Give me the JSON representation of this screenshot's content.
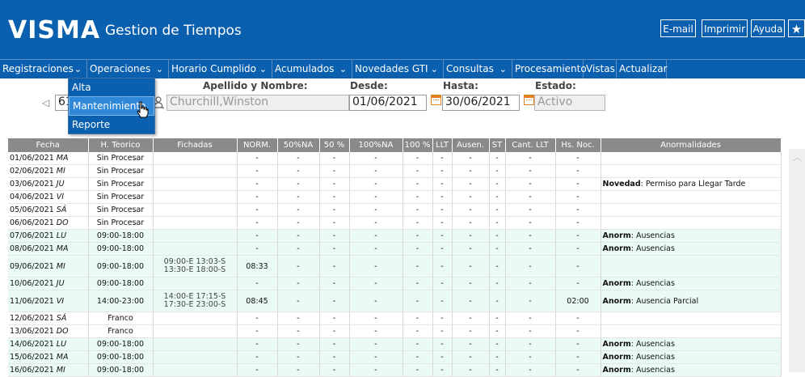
{
  "header": {
    "logo": "VISMA",
    "title": "Gestion de Tiempos",
    "buttons": {
      "email": "E-mail",
      "print": "Imprimir",
      "help": "Ayuda"
    },
    "star_icon": "star-icon"
  },
  "menu": [
    {
      "label": "Registraciones",
      "chevron": "⌄"
    },
    {
      "label": "Operaciones",
      "chevron": "⌄"
    },
    {
      "label": "Horario Cumplido",
      "chevron": "⌄"
    },
    {
      "label": "Acumulados",
      "chevron": "⌄"
    },
    {
      "label": "Novedades GTI",
      "chevron": "⌄"
    },
    {
      "label": "Consultas",
      "chevron": "⌄"
    },
    {
      "label": "Procesamiento",
      "chevron": ""
    },
    {
      "label": "Vistas",
      "chevron": ""
    },
    {
      "label": "Actualizar",
      "chevron": ""
    }
  ],
  "dropdown": [
    "Alta",
    "Mantenimiento",
    "Reporte"
  ],
  "form": {
    "name_label": "Apellido y Nombre:",
    "name_value": "Churchill,Winston",
    "legajo_value": "61",
    "desde_label": "Desde:",
    "desde_value": "01/06/2021",
    "hasta_label": "Hasta:",
    "hasta_value": "30/06/2021",
    "estado_label": "Estado:",
    "estado_value": "Activo"
  },
  "table": {
    "columns": [
      "Fecha",
      "H. Teorico",
      "Fichadas",
      "NORM.",
      "50%NA",
      "50 %",
      "100%NA",
      "100 %",
      "LLT",
      "Ausen.",
      "ST",
      "Cant. LLT",
      "Hs. Noc.",
      "Anormalidades"
    ],
    "rows": [
      {
        "date": "01/06/2021",
        "day": "MA",
        "teorico": "Sin Procesar",
        "tclass": "red",
        "f1": "",
        "f2": "",
        "norm": "-",
        "c50na": "-",
        "c50": "-",
        "c100na": "-",
        "c100": "-",
        "llt": "-",
        "ausen": "-",
        "st": "-",
        "cllt": "-",
        "noc": "-",
        "akey": "",
        "aval": "",
        "weekday": false
      },
      {
        "date": "02/06/2021",
        "day": "MI",
        "teorico": "Sin Procesar",
        "tclass": "red",
        "f1": "",
        "f2": "",
        "norm": "-",
        "c50na": "-",
        "c50": "-",
        "c100na": "-",
        "c100": "-",
        "llt": "-",
        "ausen": "-",
        "st": "-",
        "cllt": "-",
        "noc": "-",
        "akey": "",
        "aval": "",
        "weekday": false
      },
      {
        "date": "03/06/2021",
        "day": "JU",
        "teorico": "Sin Procesar",
        "tclass": "red",
        "f1": "",
        "f2": "",
        "norm": "-",
        "c50na": "-",
        "c50": "-",
        "c100na": "-",
        "c100": "-",
        "llt": "-",
        "ausen": "-",
        "st": "-",
        "cllt": "-",
        "noc": "-",
        "akey": "Novedad",
        "aval": ": Permiso para Llegar Tarde",
        "weekday": false
      },
      {
        "date": "04/06/2021",
        "day": "VI",
        "teorico": "Sin Procesar",
        "tclass": "red",
        "f1": "",
        "f2": "",
        "norm": "-",
        "c50na": "-",
        "c50": "-",
        "c100na": "-",
        "c100": "-",
        "llt": "-",
        "ausen": "-",
        "st": "-",
        "cllt": "-",
        "noc": "-",
        "akey": "",
        "aval": "",
        "weekday": false
      },
      {
        "date": "05/06/2021",
        "day": "SÁ",
        "teorico": "Sin Procesar",
        "tclass": "red",
        "f1": "",
        "f2": "",
        "norm": "-",
        "c50na": "-",
        "c50": "-",
        "c100na": "-",
        "c100": "-",
        "llt": "-",
        "ausen": "-",
        "st": "-",
        "cllt": "-",
        "noc": "-",
        "akey": "",
        "aval": "",
        "weekday": false
      },
      {
        "date": "06/06/2021",
        "day": "DO",
        "teorico": "Sin Procesar",
        "tclass": "red",
        "f1": "",
        "f2": "",
        "norm": "-",
        "c50na": "-",
        "c50": "-",
        "c100na": "-",
        "c100": "-",
        "llt": "-",
        "ausen": "-",
        "st": "-",
        "cllt": "-",
        "noc": "-",
        "akey": "",
        "aval": "",
        "weekday": false
      },
      {
        "date": "07/06/2021",
        "day": "LU",
        "teorico": "09:00-18:00",
        "tclass": "",
        "f1": "",
        "f2": "",
        "norm": "-",
        "c50na": "-",
        "c50": "-",
        "c100na": "-",
        "c100": "-",
        "llt": "-",
        "ausen": "-",
        "st": "-",
        "cllt": "-",
        "noc": "-",
        "akey": "Anorm",
        "aval": ": Ausencias",
        "weekday": true
      },
      {
        "date": "08/06/2021",
        "day": "MA",
        "teorico": "09:00-18:00",
        "tclass": "",
        "f1": "",
        "f2": "",
        "norm": "-",
        "c50na": "-",
        "c50": "-",
        "c100na": "-",
        "c100": "-",
        "llt": "-",
        "ausen": "-",
        "st": "-",
        "cllt": "-",
        "noc": "-",
        "akey": "Anorm",
        "aval": ": Ausencias",
        "weekday": true
      },
      {
        "date": "09/06/2021",
        "day": "MI",
        "teorico": "09:00-18:00",
        "tclass": "",
        "f1": "09:00-E 13:03-S",
        "f2": "13:30-E 18:00-S",
        "norm": "08:33",
        "c50na": "-",
        "c50": "-",
        "c100na": "-",
        "c100": "-",
        "llt": "-",
        "ausen": "-",
        "st": "-",
        "cllt": "-",
        "noc": "-",
        "akey": "",
        "aval": "",
        "weekday": true
      },
      {
        "date": "10/06/2021",
        "day": "JU",
        "teorico": "09:00-18:00",
        "tclass": "",
        "f1": "",
        "f2": "",
        "norm": "-",
        "c50na": "-",
        "c50": "-",
        "c100na": "-",
        "c100": "-",
        "llt": "-",
        "ausen": "-",
        "st": "-",
        "cllt": "-",
        "noc": "-",
        "akey": "Anorm",
        "aval": ": Ausencias",
        "weekday": true
      },
      {
        "date": "11/06/2021",
        "day": "VI",
        "teorico": "14:00-23:00",
        "tclass": "",
        "f1": "14:00-E 17:15-S",
        "f2": "17:30-E 23:00-S",
        "norm": "08:45",
        "c50na": "-",
        "c50": "-",
        "c100na": "-",
        "c100": "-",
        "llt": "-",
        "ausen": "-",
        "st": "-",
        "cllt": "-",
        "noc": "02:00",
        "akey": "Anorm",
        "aval": ": Ausencia Parcial",
        "weekday": true
      },
      {
        "date": "12/06/2021",
        "day": "SÁ",
        "teorico": "Franco",
        "tclass": "blue",
        "f1": "",
        "f2": "",
        "norm": "-",
        "c50na": "-",
        "c50": "-",
        "c100na": "-",
        "c100": "-",
        "llt": "-",
        "ausen": "-",
        "st": "-",
        "cllt": "-",
        "noc": "-",
        "akey": "",
        "aval": "",
        "weekday": false
      },
      {
        "date": "13/06/2021",
        "day": "DO",
        "teorico": "Franco",
        "tclass": "blue",
        "f1": "",
        "f2": "",
        "norm": "-",
        "c50na": "-",
        "c50": "-",
        "c100na": "-",
        "c100": "-",
        "llt": "-",
        "ausen": "-",
        "st": "-",
        "cllt": "-",
        "noc": "-",
        "akey": "",
        "aval": "",
        "weekday": false
      },
      {
        "date": "14/06/2021",
        "day": "LU",
        "teorico": "09:00-18:00",
        "tclass": "",
        "f1": "",
        "f2": "",
        "norm": "-",
        "c50na": "-",
        "c50": "-",
        "c100na": "-",
        "c100": "-",
        "llt": "-",
        "ausen": "-",
        "st": "-",
        "cllt": "-",
        "noc": "-",
        "akey": "Anorm",
        "aval": ": Ausencias",
        "weekday": true
      },
      {
        "date": "15/06/2021",
        "day": "MA",
        "teorico": "09:00-18:00",
        "tclass": "",
        "f1": "",
        "f2": "",
        "norm": "-",
        "c50na": "-",
        "c50": "-",
        "c100na": "-",
        "c100": "-",
        "llt": "-",
        "ausen": "-",
        "st": "-",
        "cllt": "-",
        "noc": "-",
        "akey": "Anorm",
        "aval": ": Ausencias",
        "weekday": true
      },
      {
        "date": "16/06/2021",
        "day": "MI",
        "teorico": "09:00-18:00",
        "tclass": "",
        "f1": "",
        "f2": "",
        "norm": "-",
        "c50na": "-",
        "c50": "-",
        "c100na": "-",
        "c100": "-",
        "llt": "-",
        "ausen": "-",
        "st": "-",
        "cllt": "-",
        "noc": "-",
        "akey": "Anorm",
        "aval": ": Ausencias",
        "weekday": true
      }
    ]
  }
}
